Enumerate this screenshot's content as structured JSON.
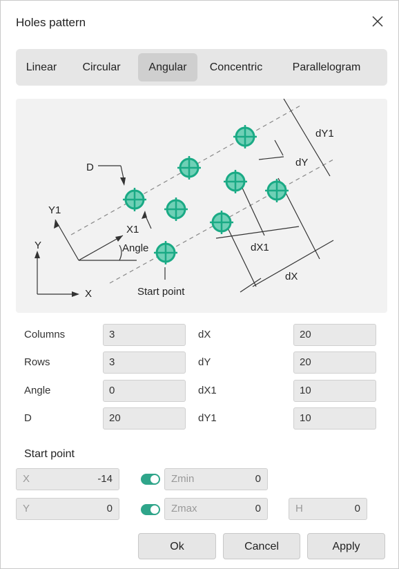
{
  "window": {
    "title": "Holes pattern"
  },
  "tabs": [
    {
      "label": "Linear"
    },
    {
      "label": "Circular"
    },
    {
      "label": "Angular",
      "active": true
    },
    {
      "label": "Concentric"
    },
    {
      "label": "Parallelogram"
    }
  ],
  "diagram": {
    "labels": {
      "d": "D",
      "y1": "Y1",
      "x1": "X1",
      "angle": "Angle",
      "y": "Y",
      "x": "X",
      "start_point": "Start point",
      "dy1": "dY1",
      "dy": "dY",
      "dx1": "dX1",
      "dx": "dX"
    },
    "hole_color": "#1aaa85"
  },
  "params": {
    "columns": {
      "label": "Columns",
      "value": "3"
    },
    "rows": {
      "label": "Rows",
      "value": "3"
    },
    "angle": {
      "label": "Angle",
      "value": "0"
    },
    "d": {
      "label": "D",
      "value": "20"
    },
    "dx": {
      "label": "dX",
      "value": "20"
    },
    "dy": {
      "label": "dY",
      "value": "20"
    },
    "dx1": {
      "label": "dX1",
      "value": "10"
    },
    "dy1": {
      "label": "dY1",
      "value": "10"
    }
  },
  "start_point": {
    "heading": "Start point",
    "x": {
      "placeholder": "X",
      "value": "-14"
    },
    "y": {
      "placeholder": "Y",
      "value": "0"
    },
    "zmin": {
      "placeholder": "Zmin",
      "value": "0",
      "enabled": true
    },
    "zmax": {
      "placeholder": "Zmax",
      "value": "0",
      "enabled": true
    },
    "h": {
      "placeholder": "H",
      "value": "0"
    }
  },
  "buttons": {
    "ok": "Ok",
    "cancel": "Cancel",
    "apply": "Apply"
  },
  "colors": {
    "accent": "#2fa58a",
    "tab_active": "#cfcfcf"
  }
}
